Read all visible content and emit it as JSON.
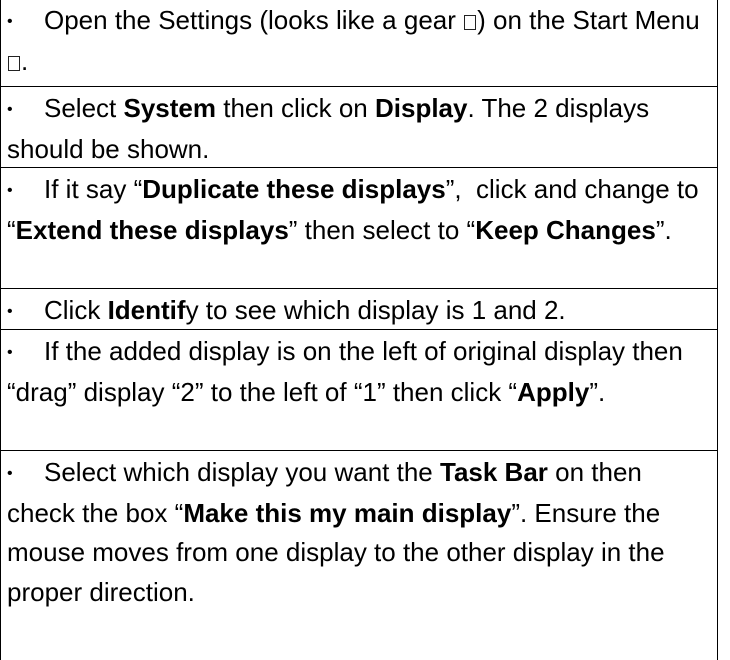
{
  "bullet_symbol": "•",
  "instructions": [
    {
      "segments": [
        {
          "text": "Open the Settings (looks like a gear ",
          "bold": false
        },
        {
          "icon": "gear-icon"
        },
        {
          "text": ") on the Start Menu  ",
          "bold": false
        },
        {
          "icon": "start-menu-icon"
        },
        {
          "text": ".",
          "bold": false
        }
      ]
    },
    {
      "segments": [
        {
          "text": "Select ",
          "bold": false
        },
        {
          "text": "System",
          "bold": true
        },
        {
          "text": " then click on ",
          "bold": false
        },
        {
          "text": "Display",
          "bold": true
        },
        {
          "text": ". The 2 displays should be shown.",
          "bold": false
        }
      ]
    },
    {
      "segments": [
        {
          "text": "If it say “",
          "bold": false
        },
        {
          "text": "Duplicate these displays",
          "bold": true
        },
        {
          "text": "”,  click and change to “",
          "bold": false
        },
        {
          "text": "Extend these displays",
          "bold": true
        },
        {
          "text": "” then select to “",
          "bold": false
        },
        {
          "text": "Keep Changes",
          "bold": true
        },
        {
          "text": "”.",
          "bold": false
        }
      ]
    },
    {
      "segments": [
        {
          "text": "Click ",
          "bold": false
        },
        {
          "text": "Identif",
          "bold": true
        },
        {
          "text": "y to see which display is 1 and 2.",
          "bold": false
        }
      ]
    },
    {
      "segments": [
        {
          "text": "If the added display is on the left of original display then “drag” display “2” to the left of “1” then click “",
          "bold": false
        },
        {
          "text": "Apply",
          "bold": true
        },
        {
          "text": "”.",
          "bold": false
        }
      ]
    },
    {
      "segments": [
        {
          "text": "Select which display you want the ",
          "bold": false
        },
        {
          "text": "Task Bar",
          "bold": true
        },
        {
          "text": " on then check the box “",
          "bold": false
        },
        {
          "text": "Make this my main display",
          "bold": true
        },
        {
          "text": "”. Ensure the mouse moves from one display to the other display in the proper direction.",
          "bold": false
        }
      ]
    }
  ]
}
